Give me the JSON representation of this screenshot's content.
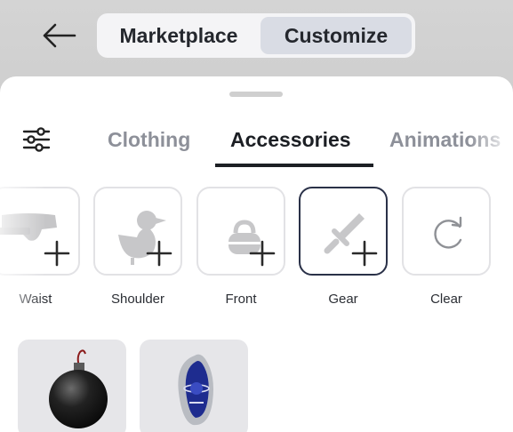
{
  "header": {
    "back_icon": "arrow-left-icon",
    "tabs": [
      {
        "label": "Marketplace",
        "selected": false
      },
      {
        "label": "Customize",
        "selected": true
      }
    ]
  },
  "categories": {
    "filter_icon": "sliders-icon",
    "tabs": [
      {
        "label": "Clothing",
        "selected": false
      },
      {
        "label": "Accessories",
        "selected": true
      },
      {
        "label": "Animations",
        "selected": false
      }
    ]
  },
  "slots": [
    {
      "label": "Waist",
      "icon": "waist-accessory-icon",
      "action_icon": "plus-icon"
    },
    {
      "label": "Shoulder",
      "icon": "bird-shoulder-icon",
      "action_icon": "plus-icon"
    },
    {
      "label": "Front",
      "icon": "bag-front-icon",
      "action_icon": "plus-icon"
    },
    {
      "label": "Gear",
      "icon": "sword-gear-icon",
      "action_icon": "plus-icon",
      "selected": true
    },
    {
      "label": "Clear",
      "icon": "refresh-icon"
    }
  ],
  "items": [
    {
      "name": "bomb",
      "icon": "bomb-icon"
    },
    {
      "name": "egg-device",
      "icon": "galaxy-egg-icon"
    }
  ],
  "colors": {
    "accent_dark": "#1c1f24",
    "selected_border": "#2a3148",
    "inactive_tab": "#8d9099"
  }
}
